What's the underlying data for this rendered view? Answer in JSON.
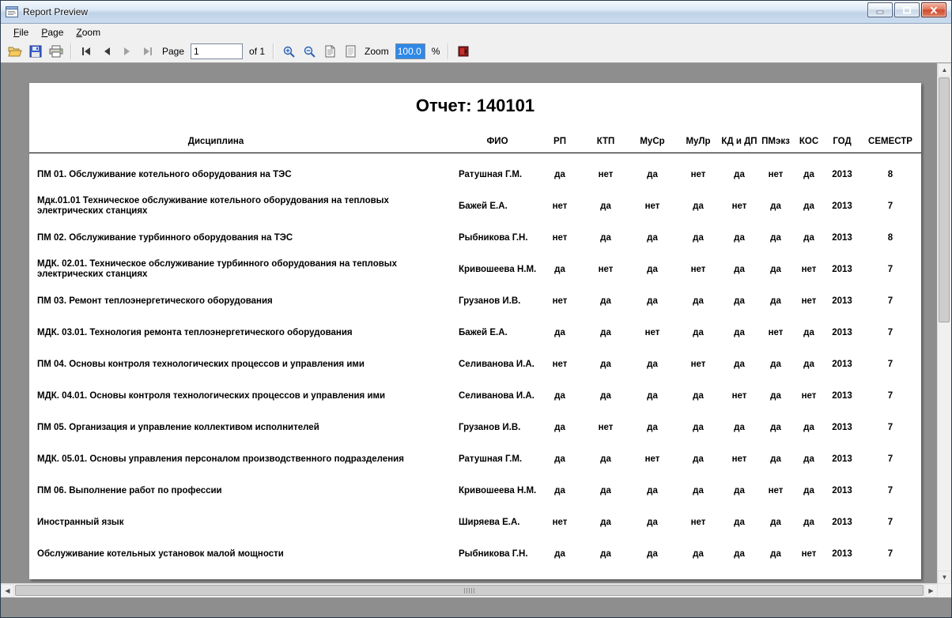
{
  "window": {
    "title": "Report Preview"
  },
  "menu": {
    "items": [
      {
        "key": "F",
        "rest": "ile"
      },
      {
        "key": "P",
        "rest": "age"
      },
      {
        "key": "Z",
        "rest": "oom"
      }
    ]
  },
  "toolbar": {
    "page_label": "Page",
    "page_value": "1",
    "of_label": "of 1",
    "zoom_label": "Zoom",
    "zoom_value": "100.0",
    "percent_label": "%",
    "icons": [
      "open-icon",
      "save-icon",
      "print-icon",
      "first-page-icon",
      "prev-page-icon",
      "next-page-icon",
      "last-page-icon",
      "zoom-in-icon",
      "zoom-out-icon",
      "page-setup-icon",
      "document-icon",
      "close-preview-icon"
    ]
  },
  "icons": {
    "up": "▲",
    "down": "▼",
    "left": "◀",
    "right": "▶"
  },
  "colors": {
    "selection_blue": "#2f89e8",
    "close_button_red": "#cf4a2d",
    "preview_background": "#8e8e8e",
    "page_background": "#ffffff"
  },
  "report": {
    "title": "Отчет: 140101",
    "columns": [
      "Дисциплина",
      "ФИО",
      "РП",
      "КТП",
      "МуСр",
      "МуЛр",
      "КД и ДП",
      "ПМэкз",
      "КОС",
      "ГОД",
      "СЕМЕСТР"
    ],
    "rows": [
      {
        "discipline": "ПМ 01. Обслуживание котельного оборудования на ТЭС",
        "fio": "Ратушная Г.М.",
        "values": [
          "да",
          "нет",
          "да",
          "нет",
          "да",
          "нет",
          "да"
        ],
        "year": "2013",
        "semester": "8"
      },
      {
        "discipline": "Мдк.01.01 Техническое обслуживание котельного оборудования на тепловых электрических станциях",
        "fio": "Бажей Е.А.",
        "values": [
          "нет",
          "да",
          "нет",
          "да",
          "нет",
          "да",
          "да"
        ],
        "year": "2013",
        "semester": "7"
      },
      {
        "discipline": "ПМ 02. Обслуживание турбинного оборудования на ТЭС",
        "fio": "Рыбникова Г.Н.",
        "values": [
          "нет",
          "да",
          "да",
          "да",
          "да",
          "да",
          "да"
        ],
        "year": "2013",
        "semester": "8"
      },
      {
        "discipline": "МДК. 02.01. Техническое обслуживание турбинного оборудования на тепловых электрических станциях",
        "fio": "Кривошеева Н.М.",
        "values": [
          "да",
          "нет",
          "да",
          "нет",
          "да",
          "да",
          "нет"
        ],
        "year": "2013",
        "semester": "7"
      },
      {
        "discipline": "ПМ 03. Ремонт теплоэнергетического оборудования",
        "fio": "Грузанов И.В.",
        "values": [
          "нет",
          "да",
          "да",
          "да",
          "да",
          "да",
          "нет"
        ],
        "year": "2013",
        "semester": "7"
      },
      {
        "discipline": "МДК. 03.01. Технология ремонта теплоэнергетического оборудования",
        "fio": "Бажей Е.А.",
        "values": [
          "да",
          "да",
          "нет",
          "да",
          "да",
          "нет",
          "да"
        ],
        "year": "2013",
        "semester": "7"
      },
      {
        "discipline": "ПМ 04. Основы контроля технологических процессов и управления ими",
        "fio": "Селиванова И.А.",
        "values": [
          "нет",
          "да",
          "да",
          "нет",
          "да",
          "да",
          "да"
        ],
        "year": "2013",
        "semester": "7"
      },
      {
        "discipline": "МДК. 04.01. Основы контроля технологических процессов и управления ими",
        "fio": "Селиванова И.А.",
        "values": [
          "да",
          "да",
          "да",
          "да",
          "нет",
          "да",
          "нет"
        ],
        "year": "2013",
        "semester": "7"
      },
      {
        "discipline": "ПМ 05. Организация и управление коллективом исполнителей",
        "fio": "Грузанов И.В.",
        "values": [
          "да",
          "нет",
          "да",
          "да",
          "да",
          "да",
          "да"
        ],
        "year": "2013",
        "semester": "7"
      },
      {
        "discipline": "МДК. 05.01. Основы управления персоналом производственного подразделения",
        "fio": "Ратушная Г.М.",
        "values": [
          "да",
          "да",
          "нет",
          "да",
          "нет",
          "да",
          "да"
        ],
        "year": "2013",
        "semester": "7"
      },
      {
        "discipline": "ПМ 06. Выполнение работ по профессии",
        "fio": "Кривошеева Н.М.",
        "values": [
          "да",
          "да",
          "да",
          "да",
          "да",
          "нет",
          "да"
        ],
        "year": "2013",
        "semester": "7"
      },
      {
        "discipline": "Иностранный язык",
        "fio": "Ширяева Е.А.",
        "values": [
          "нет",
          "да",
          "да",
          "нет",
          "да",
          "да",
          "да"
        ],
        "year": "2013",
        "semester": "7"
      },
      {
        "discipline": "Обслуживание котельных установок малой мощности",
        "fio": "Рыбникова Г.Н.",
        "values": [
          "да",
          "да",
          "да",
          "да",
          "да",
          "да",
          "нет"
        ],
        "year": "2013",
        "semester": "7"
      }
    ]
  }
}
